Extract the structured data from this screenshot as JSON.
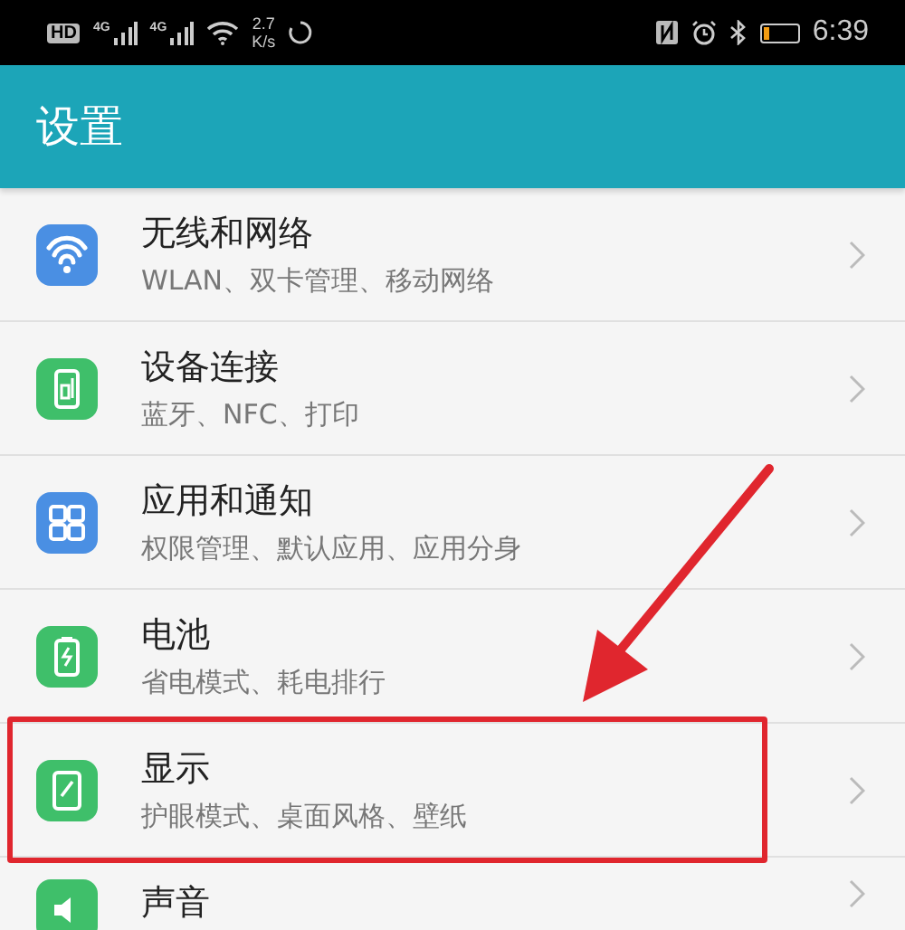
{
  "status_bar": {
    "hd": "HD",
    "network_1": "4G",
    "network_2": "4G",
    "speed_value": "2.7",
    "speed_unit": "K/s",
    "time": "6:39"
  },
  "header": {
    "title": "设置"
  },
  "items": [
    {
      "title": "无线和网络",
      "subtitle": "WLAN、双卡管理、移动网络",
      "color": "#4a8fe3",
      "highlighted": false
    },
    {
      "title": "设备连接",
      "subtitle": "蓝牙、NFC、打印",
      "color": "#3fbf6a",
      "highlighted": false
    },
    {
      "title": "应用和通知",
      "subtitle": "权限管理、默认应用、应用分身",
      "color": "#4a8fe3",
      "highlighted": false
    },
    {
      "title": "电池",
      "subtitle": "省电模式、耗电排行",
      "color": "#3fbf6a",
      "highlighted": false
    },
    {
      "title": "显示",
      "subtitle": "护眼模式、桌面风格、壁纸",
      "color": "#3fbf6a",
      "highlighted": true
    },
    {
      "title": "声音",
      "color": "#3fbf6a",
      "highlighted": false
    }
  ]
}
